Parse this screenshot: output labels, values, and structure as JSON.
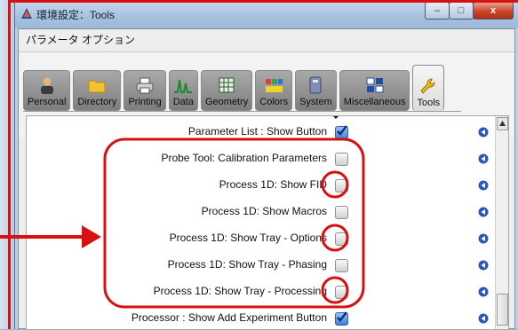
{
  "window": {
    "title": "環境設定：Tools",
    "controls": {
      "minimize": "–",
      "maximize": "□",
      "close": "x"
    }
  },
  "menu": {
    "label": "パラメータ オプション"
  },
  "tabs": [
    {
      "label": "Personal",
      "icon": "person-icon"
    },
    {
      "label": "Directory",
      "icon": "folder-icon"
    },
    {
      "label": "Printing",
      "icon": "printer-icon"
    },
    {
      "label": "Data",
      "icon": "spectrum-icon"
    },
    {
      "label": "Geometry",
      "icon": "grid-icon"
    },
    {
      "label": "Colors",
      "icon": "colors-icon"
    },
    {
      "label": "System",
      "icon": "system-icon"
    },
    {
      "label": "Miscellaneous",
      "icon": "misc-icon"
    },
    {
      "label": "Tools",
      "icon": "wrench-icon",
      "active": true
    }
  ],
  "options": [
    {
      "label": "Parameter List : Show Button",
      "checked": true
    },
    {
      "label": "Probe Tool: Calibration Parameters",
      "checked": false
    },
    {
      "label": "Process 1D: Show FID",
      "checked": false
    },
    {
      "label": "Process 1D: Show Macros",
      "checked": false
    },
    {
      "label": "Process 1D: Show Tray - Options",
      "checked": false
    },
    {
      "label": "Process 1D: Show Tray - Phasing",
      "checked": false
    },
    {
      "label": "Process 1D: Show Tray - Processing",
      "checked": false
    },
    {
      "label": "Processor : Show Add Experiment Button",
      "checked": true
    }
  ],
  "colors": {
    "annotation": "#d81010",
    "accent": "#3f7fd9"
  }
}
